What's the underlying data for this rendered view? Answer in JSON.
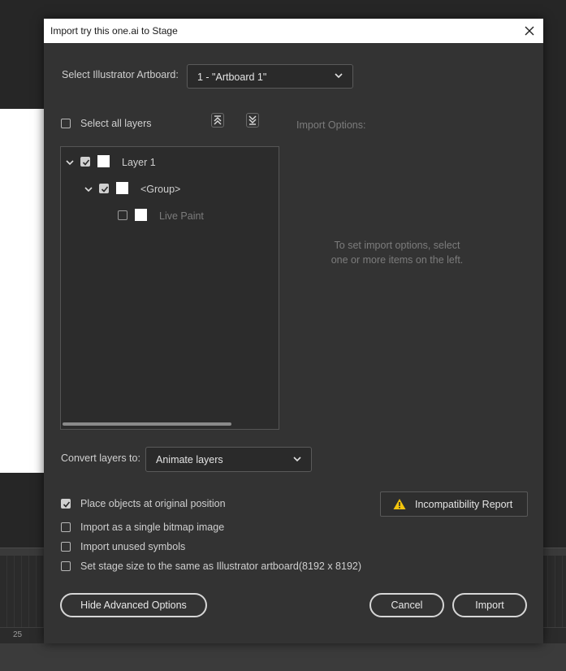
{
  "background": {
    "timeline_marker": "25"
  },
  "dialog": {
    "title": "Import try this one.ai to Stage",
    "artboard": {
      "label": "Select Illustrator Artboard:",
      "value": "1 - \"Artboard 1\""
    },
    "select_all_label": "Select all layers",
    "import_options_label": "Import Options:",
    "import_options_hint_line1": "To set import options, select",
    "import_options_hint_line2": "one or more items on the left.",
    "layers": [
      {
        "name": "Layer 1",
        "checked": true,
        "expanded": true,
        "level": 0
      },
      {
        "name": "<Group>",
        "checked": true,
        "expanded": true,
        "level": 1
      },
      {
        "name": "Live Paint",
        "checked": false,
        "expanded": false,
        "level": 2
      }
    ],
    "convert": {
      "label": "Convert layers to:",
      "value": "Animate layers"
    },
    "options": [
      {
        "label": "Place objects at original position",
        "checked": true
      },
      {
        "label": "Import as a single bitmap image",
        "checked": false
      },
      {
        "label": "Import unused symbols",
        "checked": false
      },
      {
        "label": "Set stage size to the same as Illustrator artboard(8192 x 8192)",
        "checked": false
      }
    ],
    "incompatibility_report_label": "Incompatibility Report",
    "hide_advanced_label": "Hide Advanced Options",
    "cancel_label": "Cancel",
    "import_label": "Import"
  },
  "colors": {
    "dialog_bg": "#333333",
    "titlebar_bg": "#ffffff",
    "warning_yellow": "#f2c40c"
  }
}
